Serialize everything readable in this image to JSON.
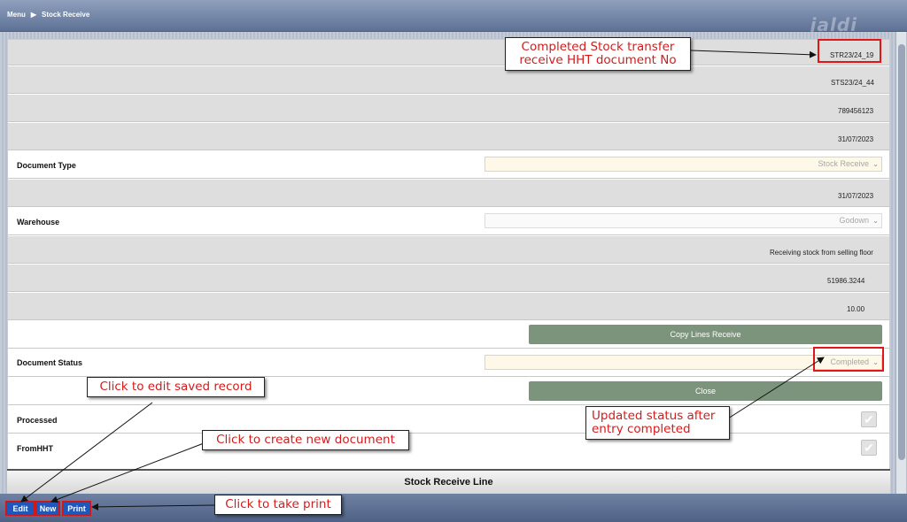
{
  "header": {
    "menu_label": "Menu",
    "page_title": "Stock Receive",
    "logo_text": "jaldi"
  },
  "form": {
    "doc_no": "STR23/24_19",
    "ref_no": "STS23/24_44",
    "number": "789456123",
    "date1": "31/07/2023",
    "document_type": {
      "label": "Document Type",
      "value": "Stock Receive"
    },
    "date2": "31/07/2023",
    "warehouse": {
      "label": "Warehouse",
      "value": "Godown"
    },
    "description": "Receiving stock from selling floor",
    "amount": "51986.3244",
    "qty": "10.00",
    "copy_lines_button": "Copy Lines Receive",
    "document_status": {
      "label": "Document Status",
      "value": "Completed"
    },
    "close_button": "Close",
    "processed": {
      "label": "Processed",
      "checked": true
    },
    "from_hht": {
      "label": "FromHHT",
      "checked": true
    }
  },
  "lines_section": {
    "title": "Stock Receive Line"
  },
  "toolbar": {
    "edit_label": "Edit",
    "new_label": "New",
    "print_label": "Print"
  },
  "annotations": {
    "doc_no_note": "Completed Stock transfer\nreceive HHT document No",
    "edit_note": "Click to edit saved record",
    "new_note": "Click to create new document",
    "print_note": "Click to take print",
    "status_note": "Updated status after\nentry completed"
  },
  "colors": {
    "header_bar": "#6f82a3",
    "action_green": "#7b947b",
    "button_blue": "#2057b8",
    "annotation_red": "#d61b1b"
  }
}
